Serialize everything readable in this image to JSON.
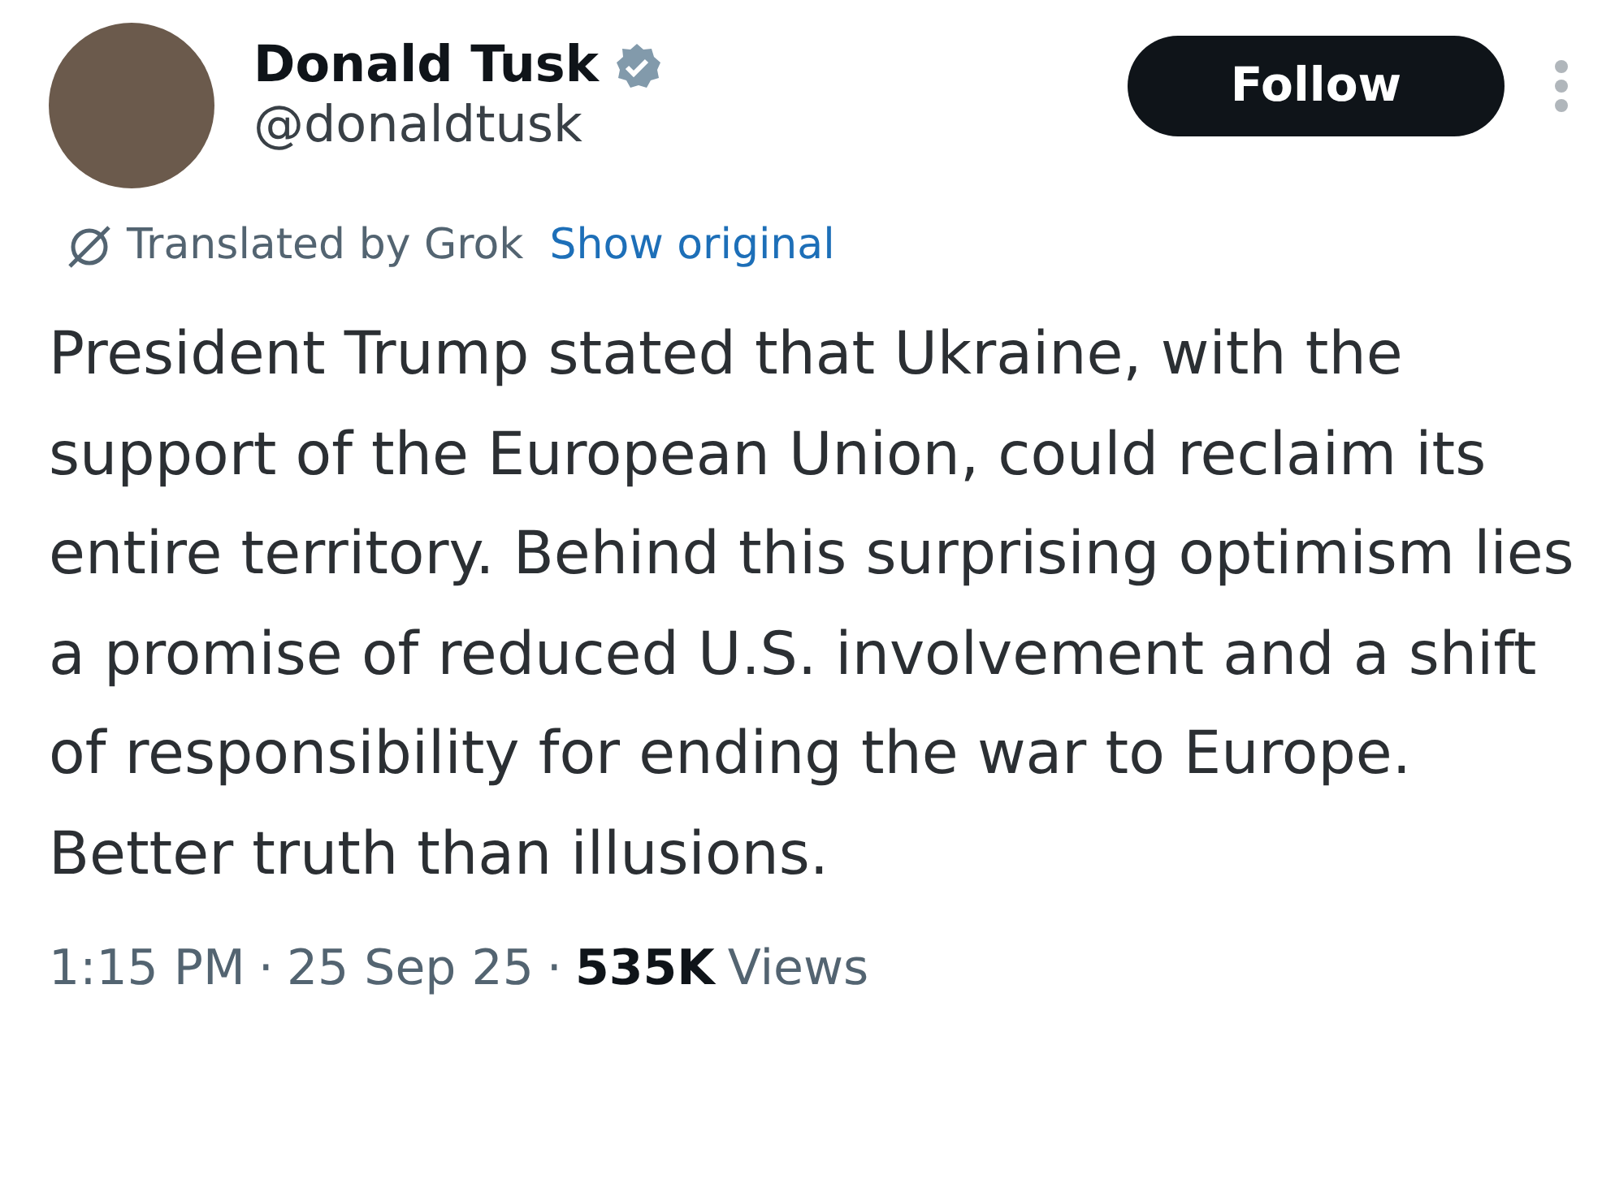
{
  "author": {
    "name": "Donald Tusk",
    "verified": true,
    "handle": "@donaldtusk"
  },
  "follow_button": {
    "label": "Follow"
  },
  "translation": {
    "label": "Translated by Grok",
    "link": "Show original"
  },
  "text": "President Trump stated that Ukraine, with the support of the European Union, could reclaim its entire territory. Behind this surprising optimism lies a promise of reduced U.S. involvement and a shift of responsibility for ending the war to Europe. Better truth than illusions.",
  "meta": {
    "time": "1:15 PM",
    "separator_1": "·",
    "date": "25 Sep 25",
    "separator_2": "·",
    "views_count": "535K",
    "views_label": "Views"
  }
}
